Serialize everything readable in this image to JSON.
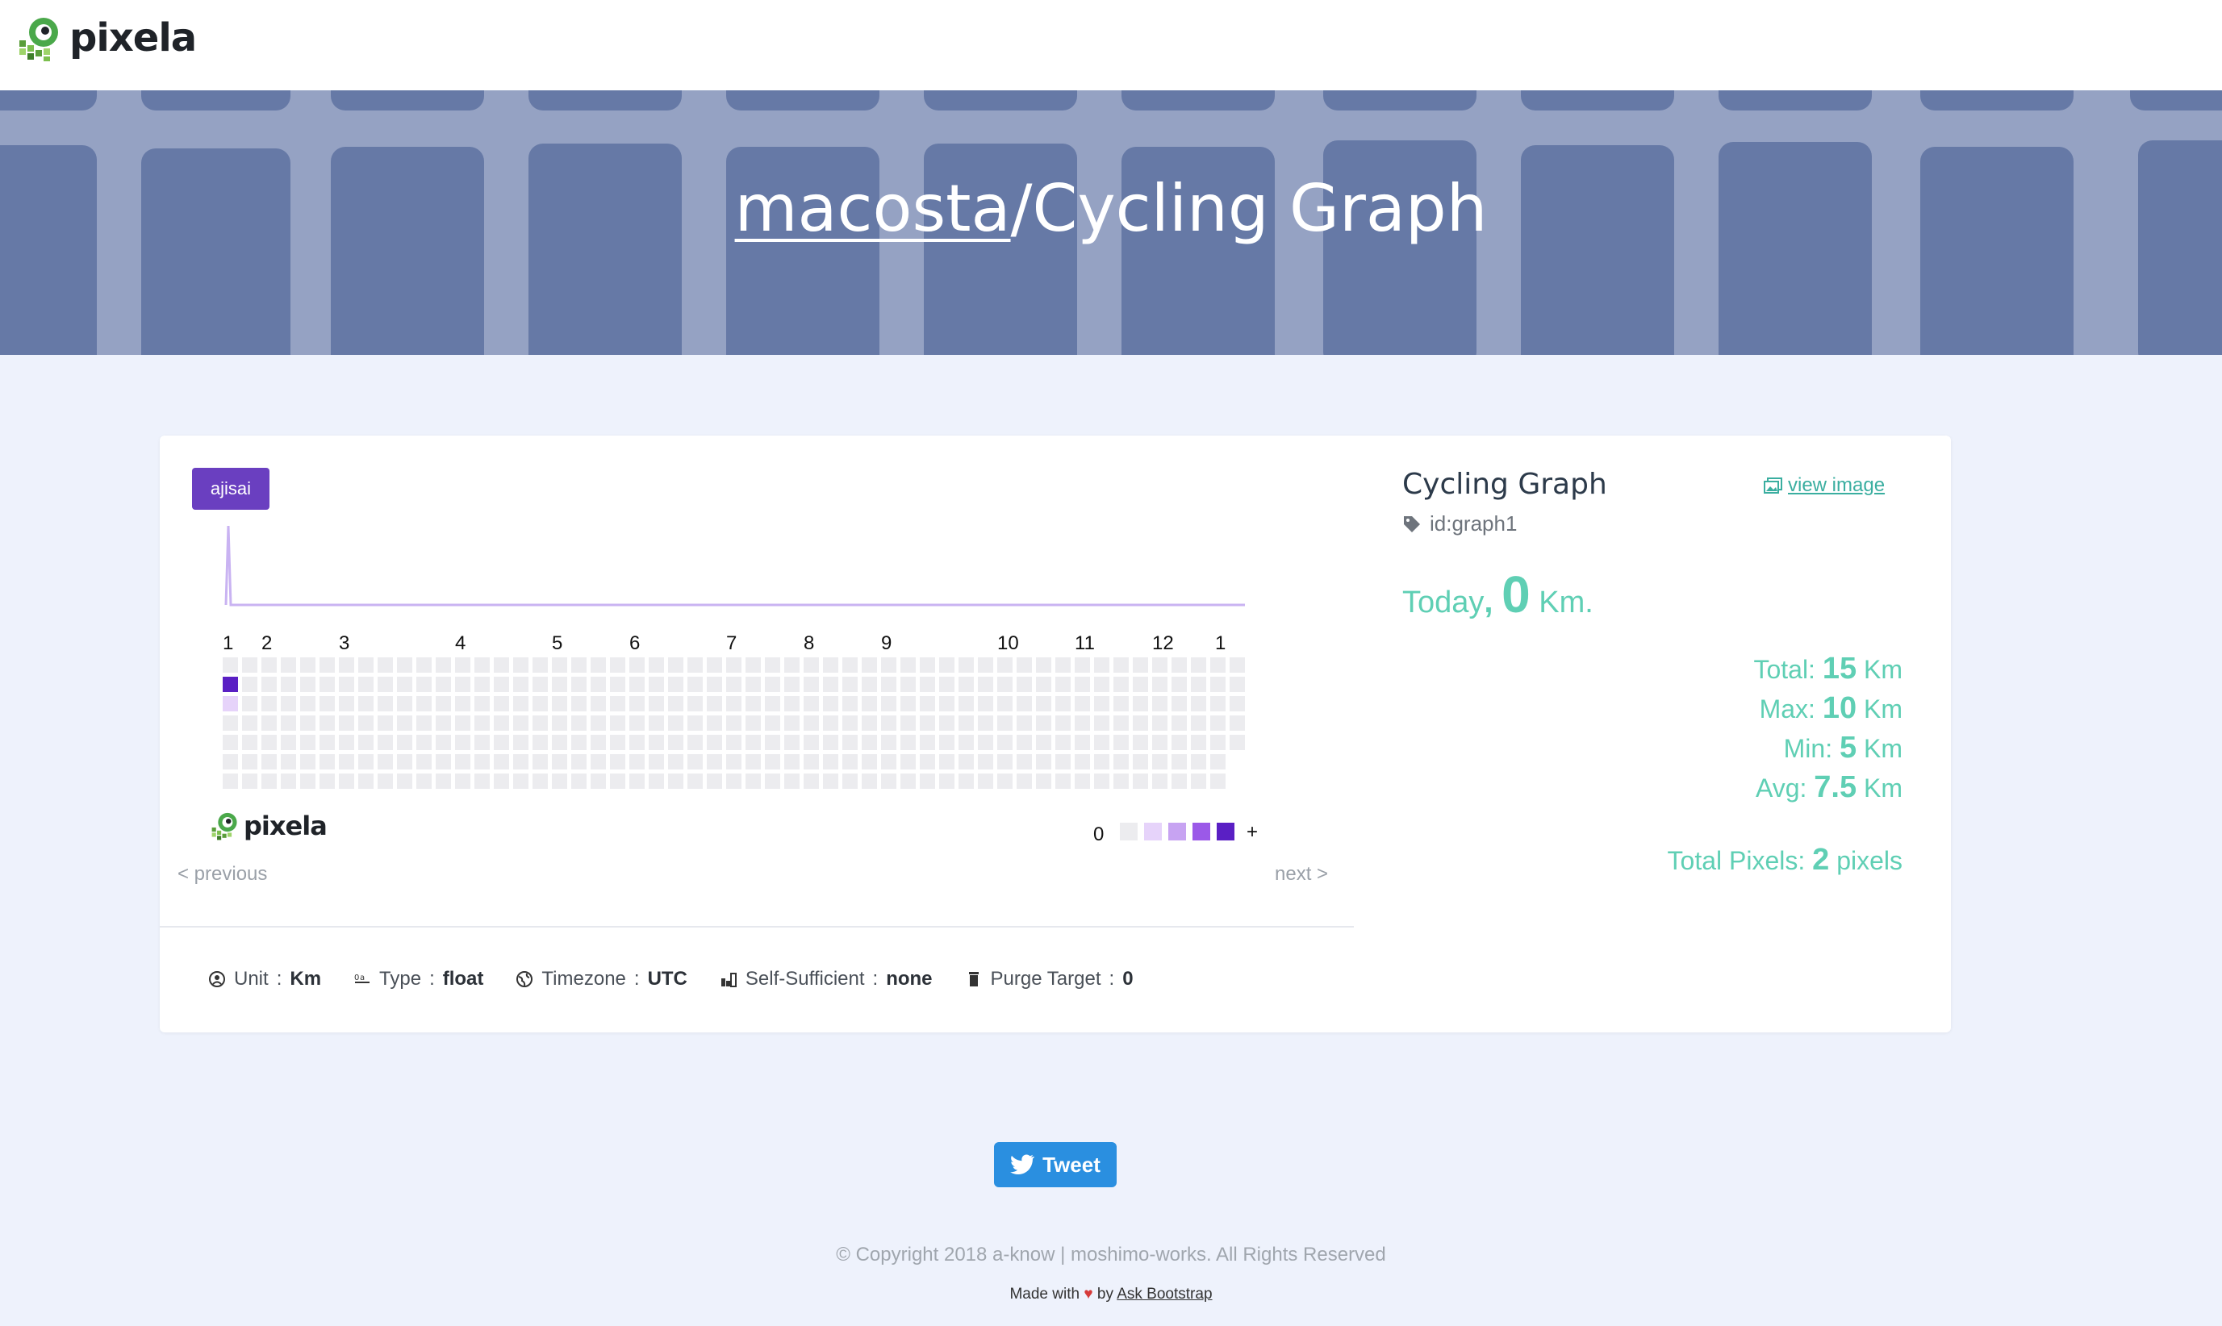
{
  "brand": {
    "name": "pixela"
  },
  "hero": {
    "user": "macosta",
    "separator": "/",
    "graph_name": "Cycling Graph"
  },
  "graph": {
    "theme_label": "ajisai",
    "month_labels": [
      "1",
      "2",
      "3",
      "4",
      "5",
      "6",
      "7",
      "8",
      "9",
      "10",
      "11",
      "12",
      "1"
    ],
    "legend": {
      "zero": "0",
      "plus": "+",
      "colors": [
        "#ececef",
        "#e6d3fa",
        "#c7a3f2",
        "#9b59e8",
        "#5a1fc4"
      ]
    },
    "active_pixels": [
      {
        "week": 0,
        "day": 1,
        "level": 4
      },
      {
        "week": 0,
        "day": 2,
        "level": 1
      }
    ],
    "previous_label": "< previous",
    "next_label": "next >"
  },
  "meta": {
    "unit_label": "Unit",
    "unit_value": "Km",
    "type_label": "Type",
    "type_value": "float",
    "timezone_label": "Timezone",
    "timezone_value": "UTC",
    "self_sufficient_label": "Self-Sufficient",
    "self_sufficient_value": "none",
    "purge_label": "Purge Target",
    "purge_value": "0",
    "colon": ":"
  },
  "info": {
    "title": "Cycling Graph",
    "view_image": "view image",
    "id_text": "id:graph1",
    "today_label": "Today",
    "today_comma": ",",
    "today_value": "0",
    "today_unit": "Km.",
    "stats": [
      {
        "label": "Total:",
        "value": "15",
        "unit": "Km"
      },
      {
        "label": "Max:",
        "value": "10",
        "unit": "Km"
      },
      {
        "label": "Min:",
        "value": "5",
        "unit": "Km"
      },
      {
        "label": "Avg:",
        "value": "7.5",
        "unit": "Km"
      }
    ],
    "total_pixels_label": "Total Pixels:",
    "total_pixels_value": "2",
    "total_pixels_unit": "pixels"
  },
  "footer": {
    "tweet": "Tweet",
    "copyright": "© Copyright 2018 a-know | moshimo-works. All Rights Reserved",
    "made_with": "Made with",
    "by": "by",
    "ask_bootstrap": "Ask Bootstrap"
  },
  "colors": {
    "accent": "#6a3fc0",
    "teal": "#5fcfb4",
    "tweet": "#2a8fe0",
    "hero": "#6678a6"
  }
}
